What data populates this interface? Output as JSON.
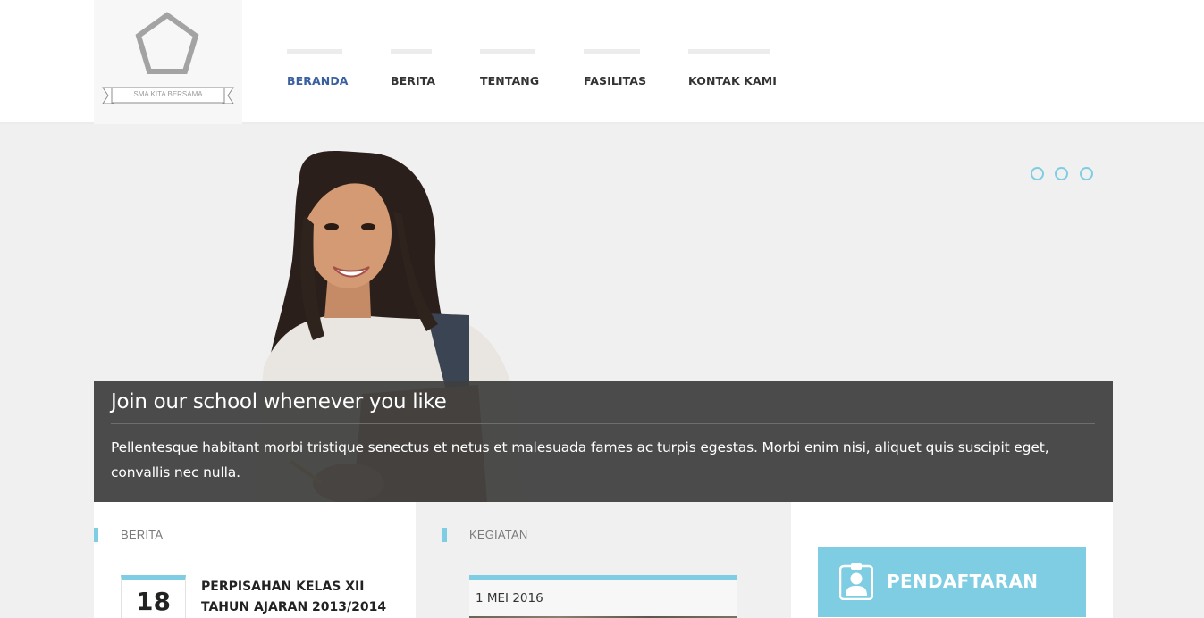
{
  "logo": {
    "text": "SMA KITA BERSAMA"
  },
  "nav": {
    "items": [
      {
        "label": "BERANDA",
        "active": true
      },
      {
        "label": "BERITA",
        "active": false
      },
      {
        "label": "TENTANG",
        "active": false
      },
      {
        "label": "FASILITAS",
        "active": false
      },
      {
        "label": "KONTAK KAMI",
        "active": false
      }
    ]
  },
  "hero": {
    "title": "Join our school whenever you like",
    "text": "Pellentesque habitant morbi tristique senectus et netus et malesuada fames ac turpis egestas. Morbi enim nisi, aliquet quis suscipit eget, convallis nec nulla.",
    "slide_count": 3
  },
  "berita": {
    "heading": "BERITA",
    "items": [
      {
        "day": "18",
        "title": "PERPISAHAN KELAS XII TAHUN AJARAN 2013/2014"
      }
    ]
  },
  "kegiatan": {
    "heading": "KEGIATAN",
    "items": [
      {
        "date": "1 MEI 2016"
      }
    ]
  },
  "pendaftaran": {
    "label": "PENDAFTARAN",
    "icon": "id-badge-icon"
  },
  "colors": {
    "accent": "#7fcde2",
    "active_nav": "#3a5fa0",
    "caption_bg": "#3e3e3e"
  }
}
